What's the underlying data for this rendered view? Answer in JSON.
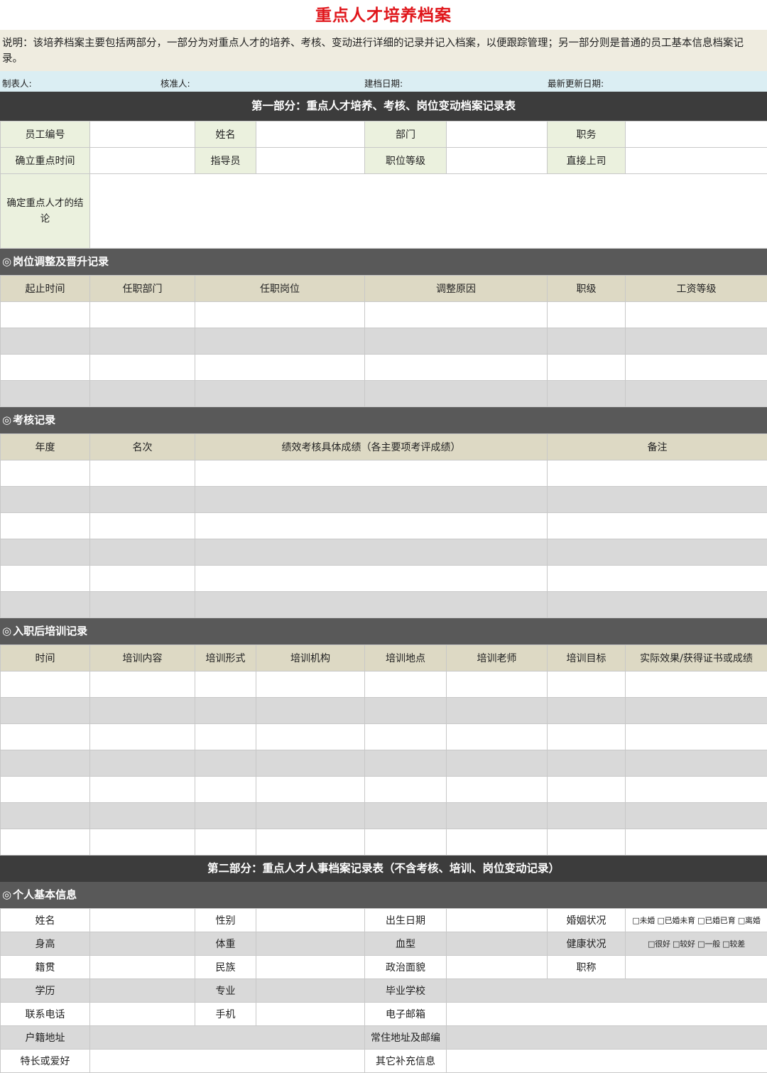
{
  "doc": {
    "title": "重点人才培养档案",
    "description": "说明：该培养档案主要包括两部分，一部分为对重点人才的培养、考核、变动进行详细的记录并记入档案，以便跟踪管理；另一部分则是普通的员工基本信息档案记录。",
    "meta": {
      "maker": "制表人:",
      "approver": "核准人:",
      "created": "建档日期:",
      "updated": "最新更新日期:"
    }
  },
  "part1": {
    "title": "第一部分：重点人才培养、考核、岗位变动档案记录表",
    "row1": [
      "员工编号",
      "姓名",
      "部门",
      "职务"
    ],
    "row2": [
      "确立重点时间",
      "指导员",
      "职位等级",
      "直接上司"
    ],
    "conclusion_label": "确定重点人才的结论"
  },
  "sections": {
    "mark": "◎",
    "position": "岗位调整及晋升记录",
    "assessment": "考核记录",
    "training": "入职后培训记录",
    "personal": "个人基本信息"
  },
  "position_headers": [
    "起止时间",
    "任职部门",
    "任职岗位",
    "调整原因",
    "职级",
    "工资等级"
  ],
  "assessment_headers": [
    "年度",
    "名次",
    "绩效考核具体成绩（各主要项考评成绩）",
    "备注"
  ],
  "training_headers": [
    "时间",
    "培训内容",
    "培训形式",
    "培训机构",
    "培训地点",
    "培训老师",
    "培训目标",
    "实际效果/获得证书或成绩"
  ],
  "part2": {
    "title": "第二部分：重点人才人事档案记录表（不含考核、培训、岗位变动记录）"
  },
  "personal": {
    "name": "姓名",
    "gender": "性别",
    "birth": "出生日期",
    "marital": "婚姻状况",
    "marital_options": "□未婚 □已婚未育 □已婚已育 □离婚",
    "height": "身高",
    "weight": "体重",
    "blood": "血型",
    "health": "健康状况",
    "health_options": "□很好 □较好 □一般 □较差",
    "native": "籍贯",
    "ethnic": "民族",
    "political": "政治面貌",
    "title": "职称",
    "education": "学历",
    "major": "专业",
    "school": "毕业学校",
    "phone": "联系电话",
    "mobile": "手机",
    "email": "电子邮箱",
    "hukou": "户籍地址",
    "address": "常住地址及邮编",
    "hobby": "特长或爱好",
    "other": "其它补充信息"
  }
}
